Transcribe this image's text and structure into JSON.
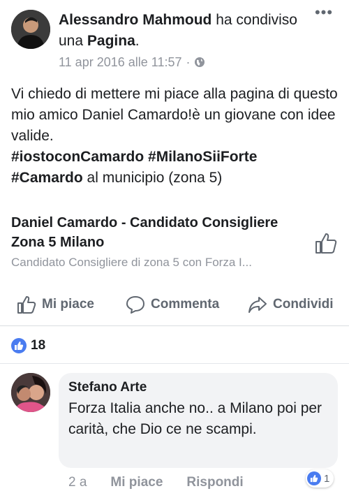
{
  "post": {
    "author": "Alessandro Mahmoud",
    "shared_text_1": "ha",
    "shared_text_2": "condiviso una",
    "shared_object": "Pagina",
    "shared_end": ".",
    "timestamp": "11 apr 2016 alle 11:57",
    "dot": "·",
    "privacy_icon": "globe-icon",
    "more_icon": "•••",
    "text_line1": "Vi chiedo di mettere mi piace alla pagina di questo mio amico Daniel Camardo!è un giovane con idee valide.",
    "hashtag1": "#iostoconCamardo",
    "hashtag2": "#MilanoSiiForte",
    "hashtag3": "#Camardo",
    "text_end": "al municipio (zona 5)"
  },
  "shared_page": {
    "title": "Daniel Camardo - Candidato Consigliere Zona 5 Milano",
    "subtitle": "Candidato Consigliere di zona 5 con Forza I..."
  },
  "actions": {
    "like": "Mi piace",
    "comment": "Commenta",
    "share": "Condividi"
  },
  "reactions": {
    "count": "18"
  },
  "comment": {
    "author": "Stefano Arte",
    "text": "Forza Italia anche no.. a Milano poi per carità, che Dio ce ne scampi.",
    "time": "2 a",
    "like": "Mi piace",
    "reply": "Rispondi",
    "like_count": "1"
  },
  "colors": {
    "accent": "#4a7cf0",
    "secondary_text": "#90949c",
    "action_text": "#606770"
  }
}
